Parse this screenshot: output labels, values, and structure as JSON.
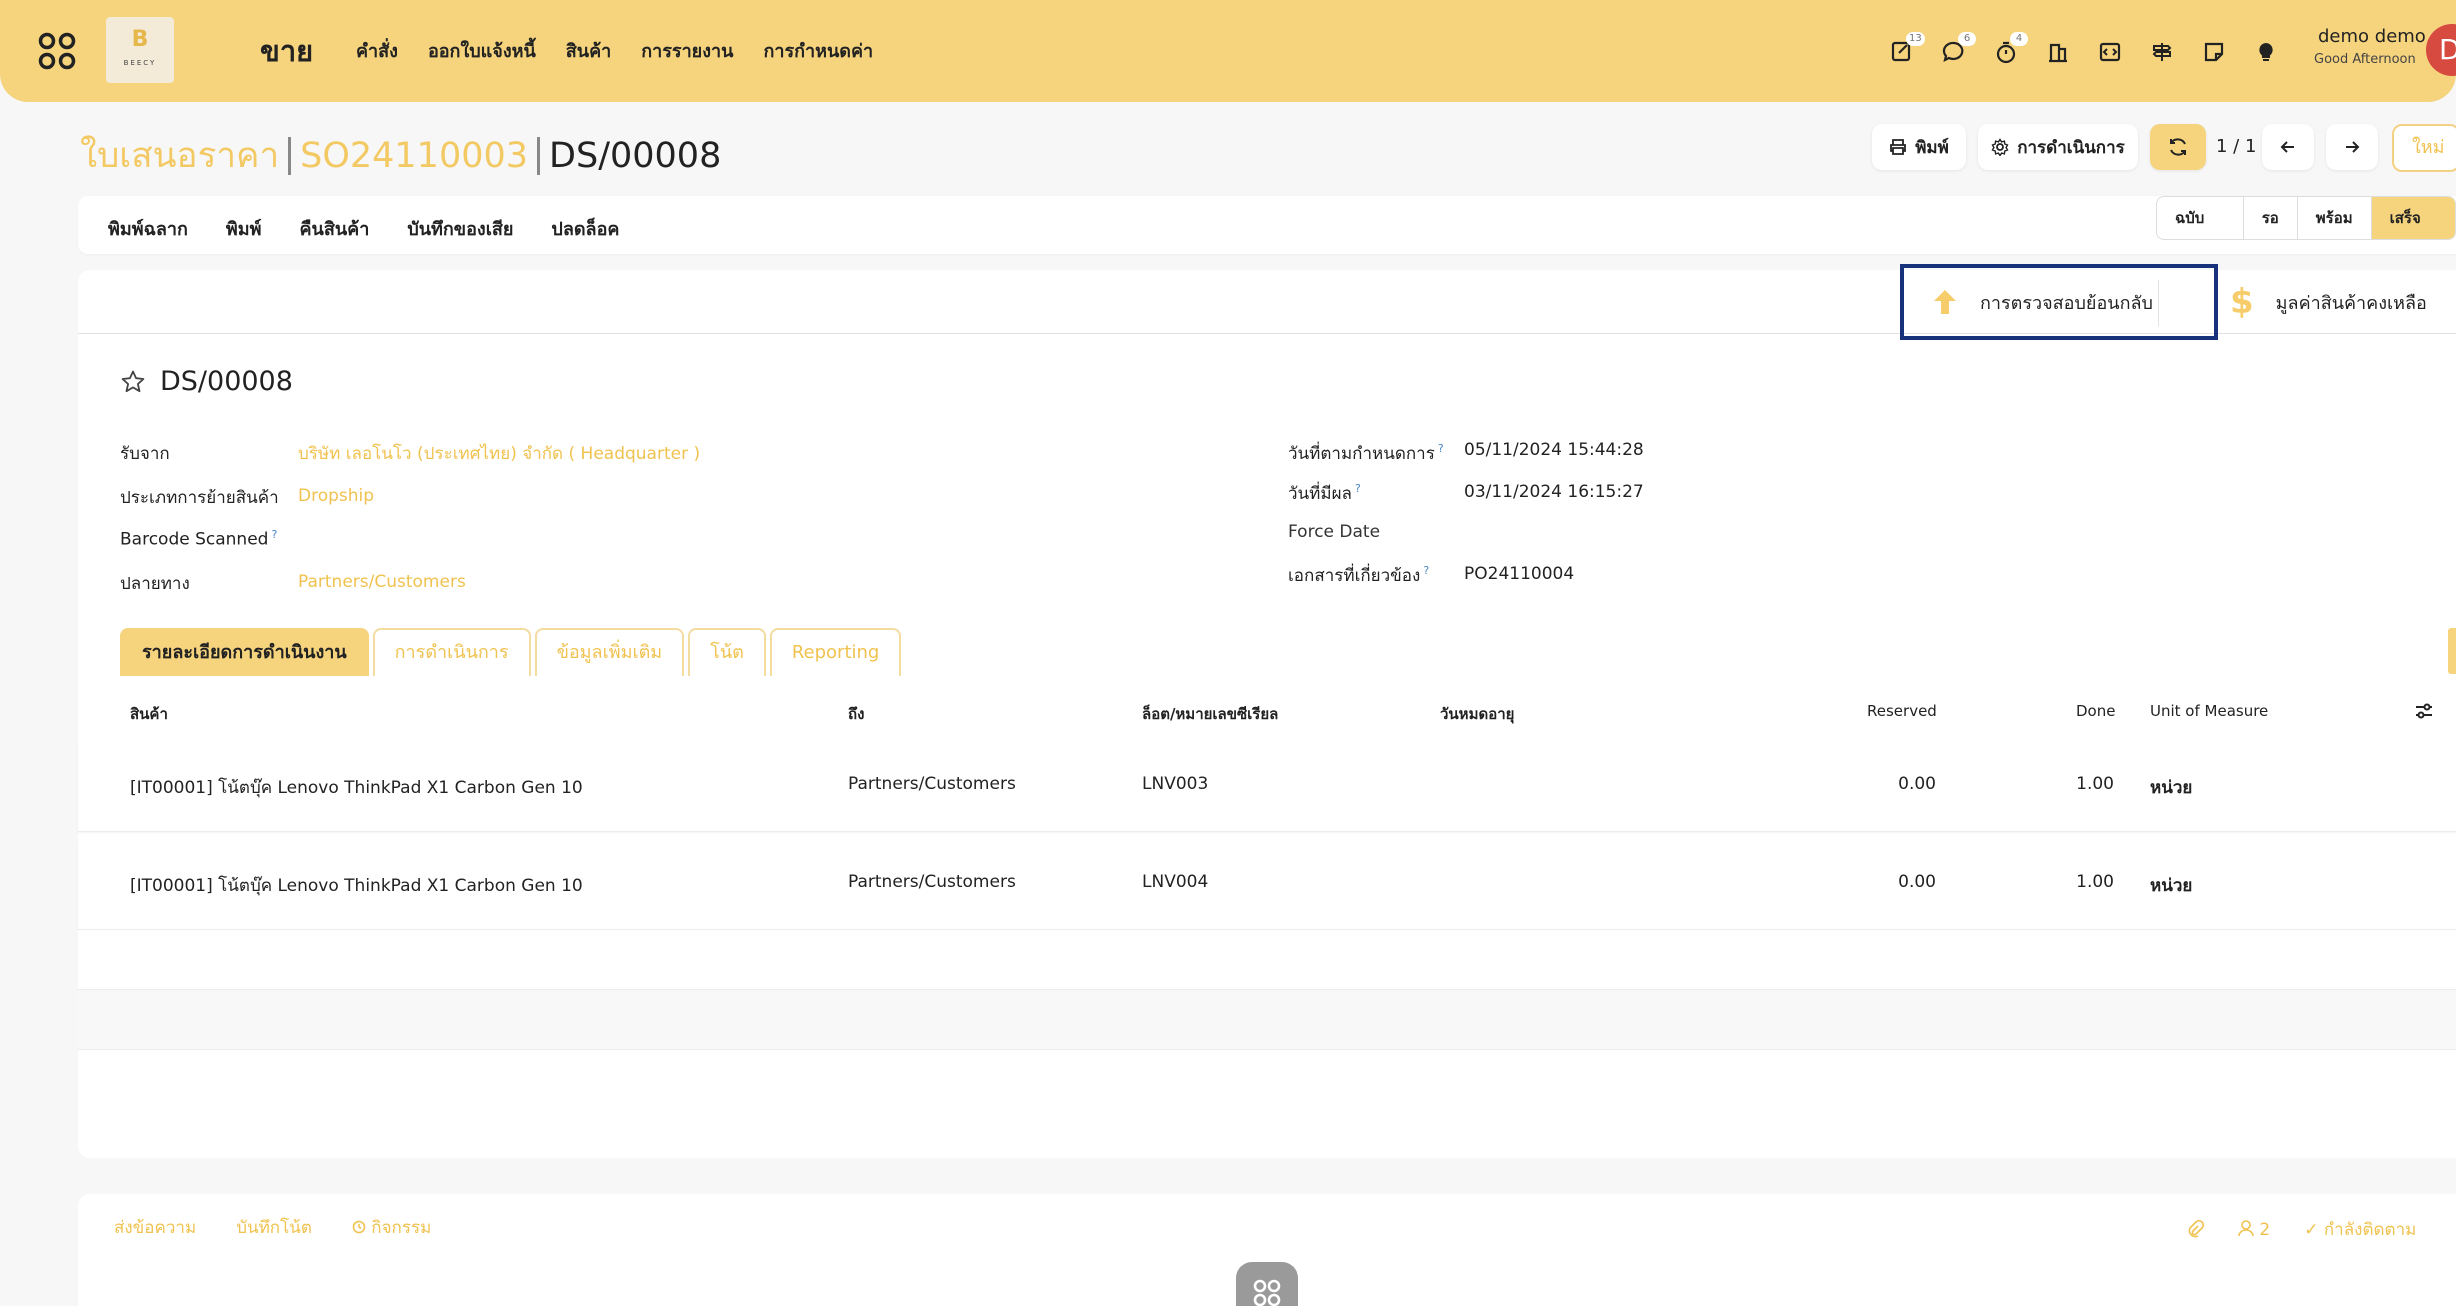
{
  "topbar": {
    "logo_text": "BEECY",
    "brand": "ขาย",
    "nav": [
      "คำสั่ง",
      "ออกใบแจ้งหนี้",
      "สินค้า",
      "การรายงาน",
      "การกำหนดค่า"
    ],
    "icons": [
      {
        "name": "activity-icon",
        "count": "13"
      },
      {
        "name": "chat-icon",
        "count": "6"
      },
      {
        "name": "timer-icon",
        "count": "4"
      },
      {
        "name": "building-icon",
        "count": ""
      },
      {
        "name": "code-icon",
        "count": ""
      },
      {
        "name": "signpost-icon",
        "count": ""
      },
      {
        "name": "note-icon",
        "count": ""
      },
      {
        "name": "lightbulb-icon",
        "count": ""
      }
    ],
    "user_name": "demo demo",
    "greeting": "Good Afternoon",
    "avatar_letter": "D"
  },
  "breadcrumb": {
    "root": "ใบเสนอราคา",
    "parent": "SO24110003",
    "current": "DS/00008"
  },
  "controls": {
    "print": "พิมพ์",
    "action": "การดำเนินการ",
    "pager": "1 / 1",
    "new": "ใหม่"
  },
  "action_bar": [
    "พิมพ์ฉลาก",
    "พิมพ์",
    "คืนสินค้า",
    "บันทึกของเสีย",
    "ปลดล็อค"
  ],
  "status_bar": {
    "steps": [
      "ฉบับร่าง",
      "รอ",
      "พร้อม",
      "เสร็จสิ้น"
    ],
    "active": "เสร็จสิ้น"
  },
  "smart_buttons": {
    "traceability": "การตรวจสอบย้อนกลับ",
    "valuation": "มูลค่าสินค้าคงเหลือ"
  },
  "record": {
    "title": "DS/00008",
    "fields_left": [
      {
        "label": "รับจาก",
        "value": "บริษัท เลอโนโว (ประเทศไทย) จำกัด ( Headquarter )"
      },
      {
        "label": "ประเภทการย้ายสินค้า",
        "value": "Dropship"
      },
      {
        "label": "Barcode Scanned",
        "value": ""
      },
      {
        "label": "ปลายทาง",
        "value": "Partners/Customers"
      }
    ],
    "fields_right": [
      {
        "label": "วันที่ตามกำหนดการ",
        "value": "05/11/2024 15:44:28"
      },
      {
        "label": "วันที่มีผล",
        "value": "03/11/2024 16:15:27"
      },
      {
        "label": "Force Date",
        "value": ""
      },
      {
        "label": "เอกสารที่เกี่ยวข้อง",
        "value": "PO24110004"
      }
    ]
  },
  "tabs": [
    "รายละเอียดการดำเนินงาน",
    "การดำเนินการ",
    "ข้อมูลเพิ่มเติม",
    "โน้ต",
    "Reporting"
  ],
  "table": {
    "headers": {
      "product": "สินค้า",
      "to": "ถึง",
      "lot": "ล็อต/หมายเลขซีเรียล",
      "expiry": "วันหมดอายุ",
      "reserved": "Reserved",
      "done": "Done",
      "uom": "Unit of Measure"
    },
    "rows": [
      {
        "product": "[IT00001] โน้ตบุ๊ค Lenovo ThinkPad X1 Carbon Gen 10",
        "to": "Partners/Customers",
        "lot": "LNV003",
        "expiry": "",
        "reserved": "0.00",
        "done": "1.00",
        "uom": "หน่วย"
      },
      {
        "product": "[IT00001] โน้ตบุ๊ค Lenovo ThinkPad X1 Carbon Gen 10",
        "to": "Partners/Customers",
        "lot": "LNV004",
        "expiry": "",
        "reserved": "0.00",
        "done": "1.00",
        "uom": "หน่วย"
      }
    ]
  },
  "chatter": {
    "send_message": "ส่งข้อความ",
    "log_note": "บันทึกโน้ต",
    "activities": "กิจกรรม",
    "followers_count": "2",
    "following": "กำลังติดตาม"
  },
  "colors": {
    "accent": "#f6d47e",
    "link": "#f0c24f",
    "highlight_border": "#17327a"
  }
}
